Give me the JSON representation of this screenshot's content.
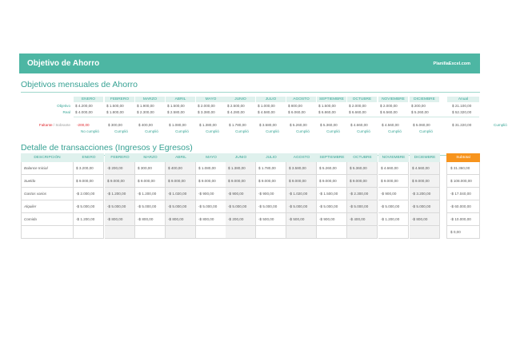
{
  "banner": {
    "title": "Objetivo de Ahorro",
    "brand": "PlanillaExcel.com"
  },
  "monthly": {
    "title": "Objetivos mensuales de Ahorro",
    "months": [
      "ENERO",
      "FEBRERO",
      "MARZO",
      "ABRIL",
      "MAYO",
      "JUNIO",
      "JULIO",
      "AGOSTO",
      "SEPTIEMBRE",
      "OCTUBRE",
      "NOVIEMBRE",
      "DICIEMBRE"
    ],
    "annual_label": "Anual",
    "objective_label": "Objetivo",
    "real_label": "Real",
    "faltante_label": "Faltante",
    "sobrante_label": " / Sobrante",
    "objective": [
      "$ 4.200,00",
      "$ 1.500,00",
      "$ 1.900,00",
      "$ 1.500,00",
      "$ 2.000,00",
      "$ 2.500,00",
      "$ 1.000,00",
      "$ 800,00",
      "$ 1.500,00",
      "$ 2.000,00",
      "$ 2.000,00",
      "$ 200,00"
    ],
    "objective_annual": "$ 21.100,00",
    "real": [
      "$ 4.000,00",
      "$ 1.800,00",
      "$ 2.300,00",
      "$ 2.580,00",
      "$ 3.380,00",
      "$ 4.280,00",
      "$ 4.580,00",
      "$ 6.060,00",
      "$ 6.860,00",
      "$ 6.660,00",
      "$ 6.560,00",
      "$ 5.260,00"
    ],
    "real_annual": "$ 52.320,00",
    "faltante": [
      "-200,00",
      "$ 300,00",
      "$ 400,00",
      "$ 1.080,00",
      "$ 1.380,00",
      "$ 1.780,00",
      "$ 3.580,00",
      "$ 5.260,00",
      "$ 5.360,00",
      "$ 4.660,00",
      "$ 4.560,00",
      "$ 5.060,00"
    ],
    "faltante_annual": "$ 31.220,00",
    "status": [
      "No cumplió",
      "Cumplió",
      "Cumplió",
      "Cumplió",
      "Cumplió",
      "Cumplió",
      "Cumplió",
      "Cumplió",
      "Cumplió",
      "Cumplió",
      "Cumplió",
      "Cumplió"
    ],
    "status_annual": "Cumplió"
  },
  "transactions": {
    "title": "Detalle de transacciones (Ingresos y Egresos)",
    "description_header": "DESCRIPCIÓN",
    "subtotal_header": "Subtotal",
    "rows": [
      {
        "label": "Balance Inicial",
        "values": [
          "$ 3.200,00",
          "-$ 200,00",
          "$ 300,00",
          "$ 400,00",
          "$ 1.080,00",
          "$ 1.380,00",
          "$ 1.780,00",
          "$ 3.580,00",
          "$ 5.260,00",
          "$ 5.360,00",
          "$ 4.660,00",
          "$ 4.560,00"
        ],
        "subtotal": "$ 31.360,00"
      },
      {
        "label": "Sueldo",
        "values": [
          "$ 9.000,00",
          "$ 9.000,00",
          "$ 9.000,00",
          "$ 9.000,00",
          "$ 9.000,00",
          "$ 9.000,00",
          "$ 9.000,00",
          "$ 9.000,00",
          "$ 9.000,00",
          "$ 9.000,00",
          "$ 9.000,00",
          "$ 9.000,00"
        ],
        "subtotal": "$ 108.000,00"
      },
      {
        "label": "Gastos varios",
        "values": [
          "-$ 2.000,00",
          "-$ 1.200,00",
          "-$ 1.200,00",
          "-$ 1.020,00",
          "-$ 900,00",
          "-$ 900,00",
          "-$ 900,00",
          "-$ 1.020,00",
          "-$ 1.500,00",
          "-$ 2.300,00",
          "-$ 900,00",
          "-$ 3.200,00"
        ],
        "subtotal": "-$ 17.040,00"
      },
      {
        "label": "Alquiler",
        "values": [
          "-$ 5.000,00",
          "-$ 5.000,00",
          "-$ 5.000,00",
          "-$ 5.000,00",
          "-$ 5.000,00",
          "-$ 5.000,00",
          "-$ 5.000,00",
          "-$ 5.000,00",
          "-$ 5.000,00",
          "-$ 5.000,00",
          "-$ 5.000,00",
          "-$ 5.000,00"
        ],
        "subtotal": "-$ 60.000,00"
      },
      {
        "label": "Comida",
        "values": [
          "-$ 1.200,00",
          "-$ 800,00",
          "-$ 800,00",
          "-$ 800,00",
          "-$ 800,00",
          "-$ 200,00",
          "-$ 500,00",
          "-$ 500,00",
          "-$ 900,00",
          "-$ 400,00",
          "-$ 1.200,00",
          "-$ 800,00"
        ],
        "subtotal": "-$ 10.000,00"
      },
      {
        "label": "",
        "values": [
          "",
          "",
          "",
          "",
          "",
          "",
          "",
          "",
          "",
          "",
          "",
          ""
        ],
        "subtotal": "$ 0,00"
      }
    ]
  },
  "colors": {
    "accent": "#4db6a3",
    "negative": "#e0282e",
    "subtotal": "#f7941d"
  }
}
